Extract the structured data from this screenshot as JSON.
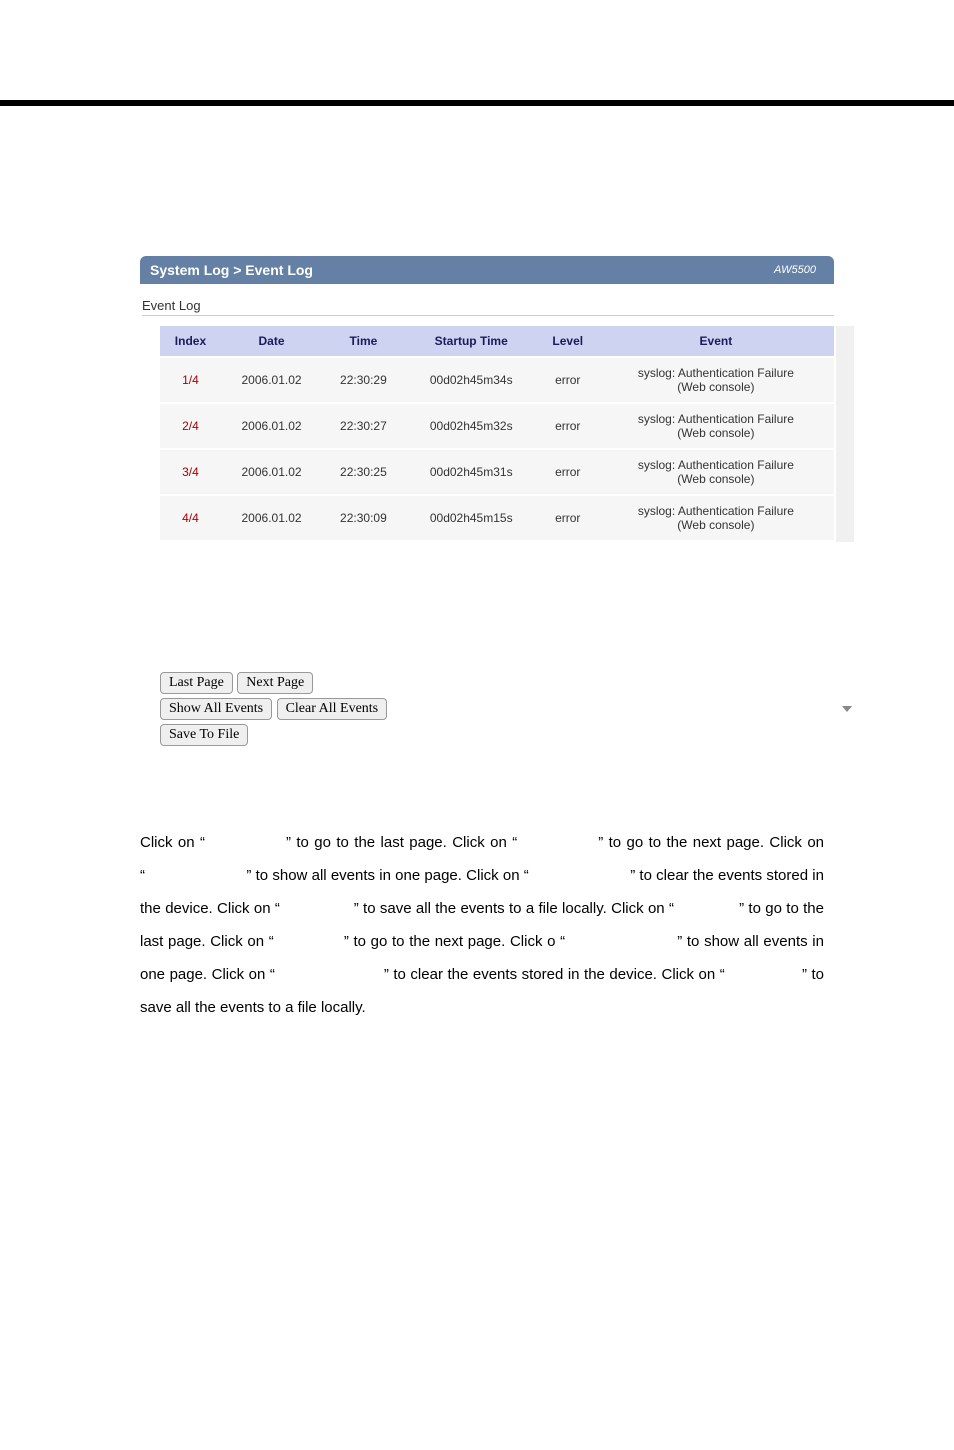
{
  "header": {
    "breadcrumb": "System Log > Event Log",
    "model": "AW5500"
  },
  "section_title": "Event Log",
  "table": {
    "headers": {
      "index": "Index",
      "date": "Date",
      "time": "Time",
      "startup": "Startup Time",
      "level": "Level",
      "event": "Event"
    },
    "rows": [
      {
        "index": "1/4",
        "date": "2006.01.02",
        "time": "22:30:29",
        "startup": "00d02h45m34s",
        "level": "error",
        "event_l1": "syslog: Authentication Failure",
        "event_l2": "(Web console)"
      },
      {
        "index": "2/4",
        "date": "2006.01.02",
        "time": "22:30:27",
        "startup": "00d02h45m32s",
        "level": "error",
        "event_l1": "syslog: Authentication Failure",
        "event_l2": "(Web console)"
      },
      {
        "index": "3/4",
        "date": "2006.01.02",
        "time": "22:30:25",
        "startup": "00d02h45m31s",
        "level": "error",
        "event_l1": "syslog: Authentication Failure",
        "event_l2": "(Web console)"
      },
      {
        "index": "4/4",
        "date": "2006.01.02",
        "time": "22:30:09",
        "startup": "00d02h45m15s",
        "level": "error",
        "event_l1": "syslog: Authentication Failure",
        "event_l2": "(Web console)"
      }
    ]
  },
  "buttons": {
    "last_page": "Last Page",
    "next_page": "Next Page",
    "show_all": "Show All Events",
    "clear_all": "Clear All Events",
    "save_to_file": "Save To File"
  },
  "paragraph": {
    "t1": "Click on “",
    "t2": "” to go to the last page. Click on “",
    "t3": "” to go to the next page. Click on “",
    "t4": "” to show all events in one page. Click on “",
    "t5": "” to clear the events stored in the device. Click on “",
    "t6": "” to save all the events to a file locally. Click on “",
    "t7": "” to go to the last page. Click on “",
    "t8": "” to go to the next page. Click o “",
    "t9": "” to show all events in one page. Click on “",
    "t10": "” to clear the events stored in the device. Click on “",
    "t11": "” to save all the events to a file locally."
  }
}
